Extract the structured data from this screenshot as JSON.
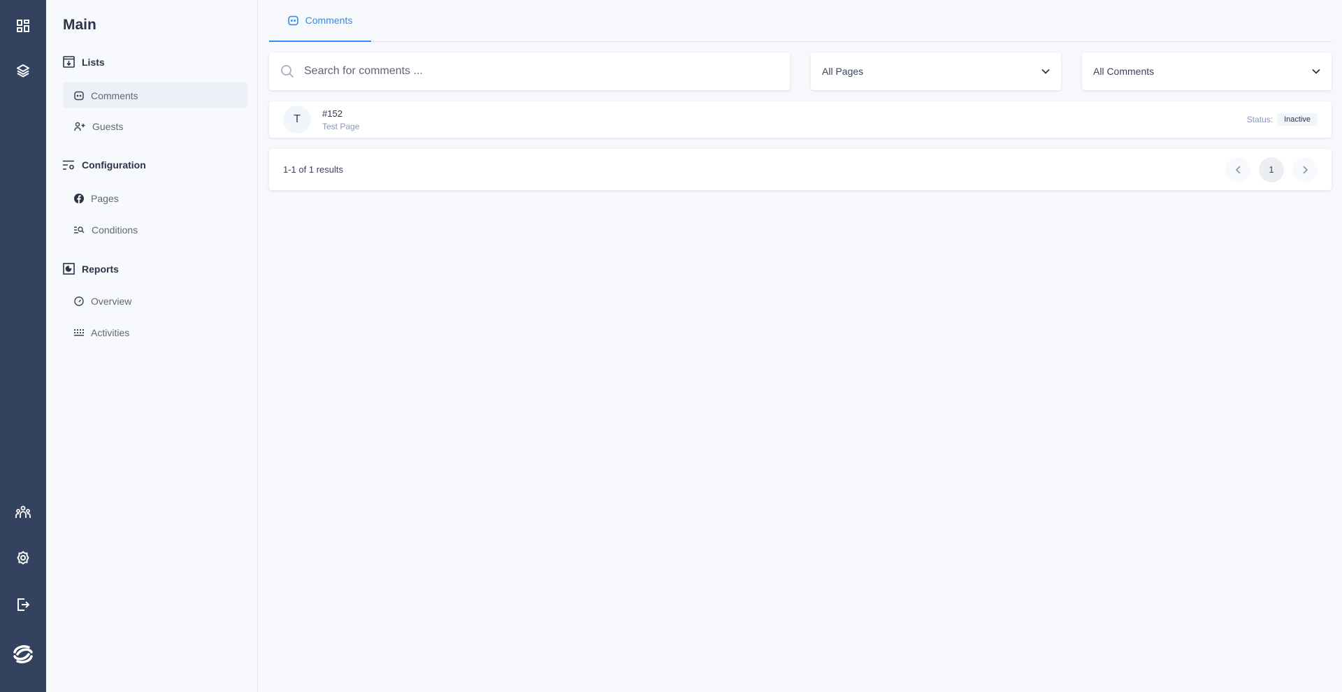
{
  "rail": {
    "icons": [
      "dashboard-icon",
      "layers-icon",
      "team-icon",
      "settings-icon",
      "logout-icon",
      "logo-icon"
    ]
  },
  "sidebar": {
    "title": "Main",
    "sections": [
      {
        "label": "Lists",
        "items": [
          {
            "label": "Comments",
            "active": true
          },
          {
            "label": "Guests"
          }
        ]
      },
      {
        "label": "Configuration",
        "items": [
          {
            "label": "Pages"
          },
          {
            "label": "Conditions"
          }
        ]
      },
      {
        "label": "Reports",
        "items": [
          {
            "label": "Overview"
          },
          {
            "label": "Activities"
          }
        ]
      }
    ]
  },
  "tabs": [
    {
      "label": "Comments",
      "active": true
    }
  ],
  "filters": {
    "search_placeholder": "Search for comments ...",
    "pages": "All Pages",
    "comments": "All Comments"
  },
  "rows": [
    {
      "avatar": "T",
      "id": "#152",
      "page": "Test Page",
      "status_label": "Status:",
      "status": "Inactive"
    }
  ],
  "pagination": {
    "summary": "1-1 of 1 results",
    "current": "1"
  },
  "colors": {
    "rail": "#33425f",
    "accent": "#2f8cf0"
  }
}
